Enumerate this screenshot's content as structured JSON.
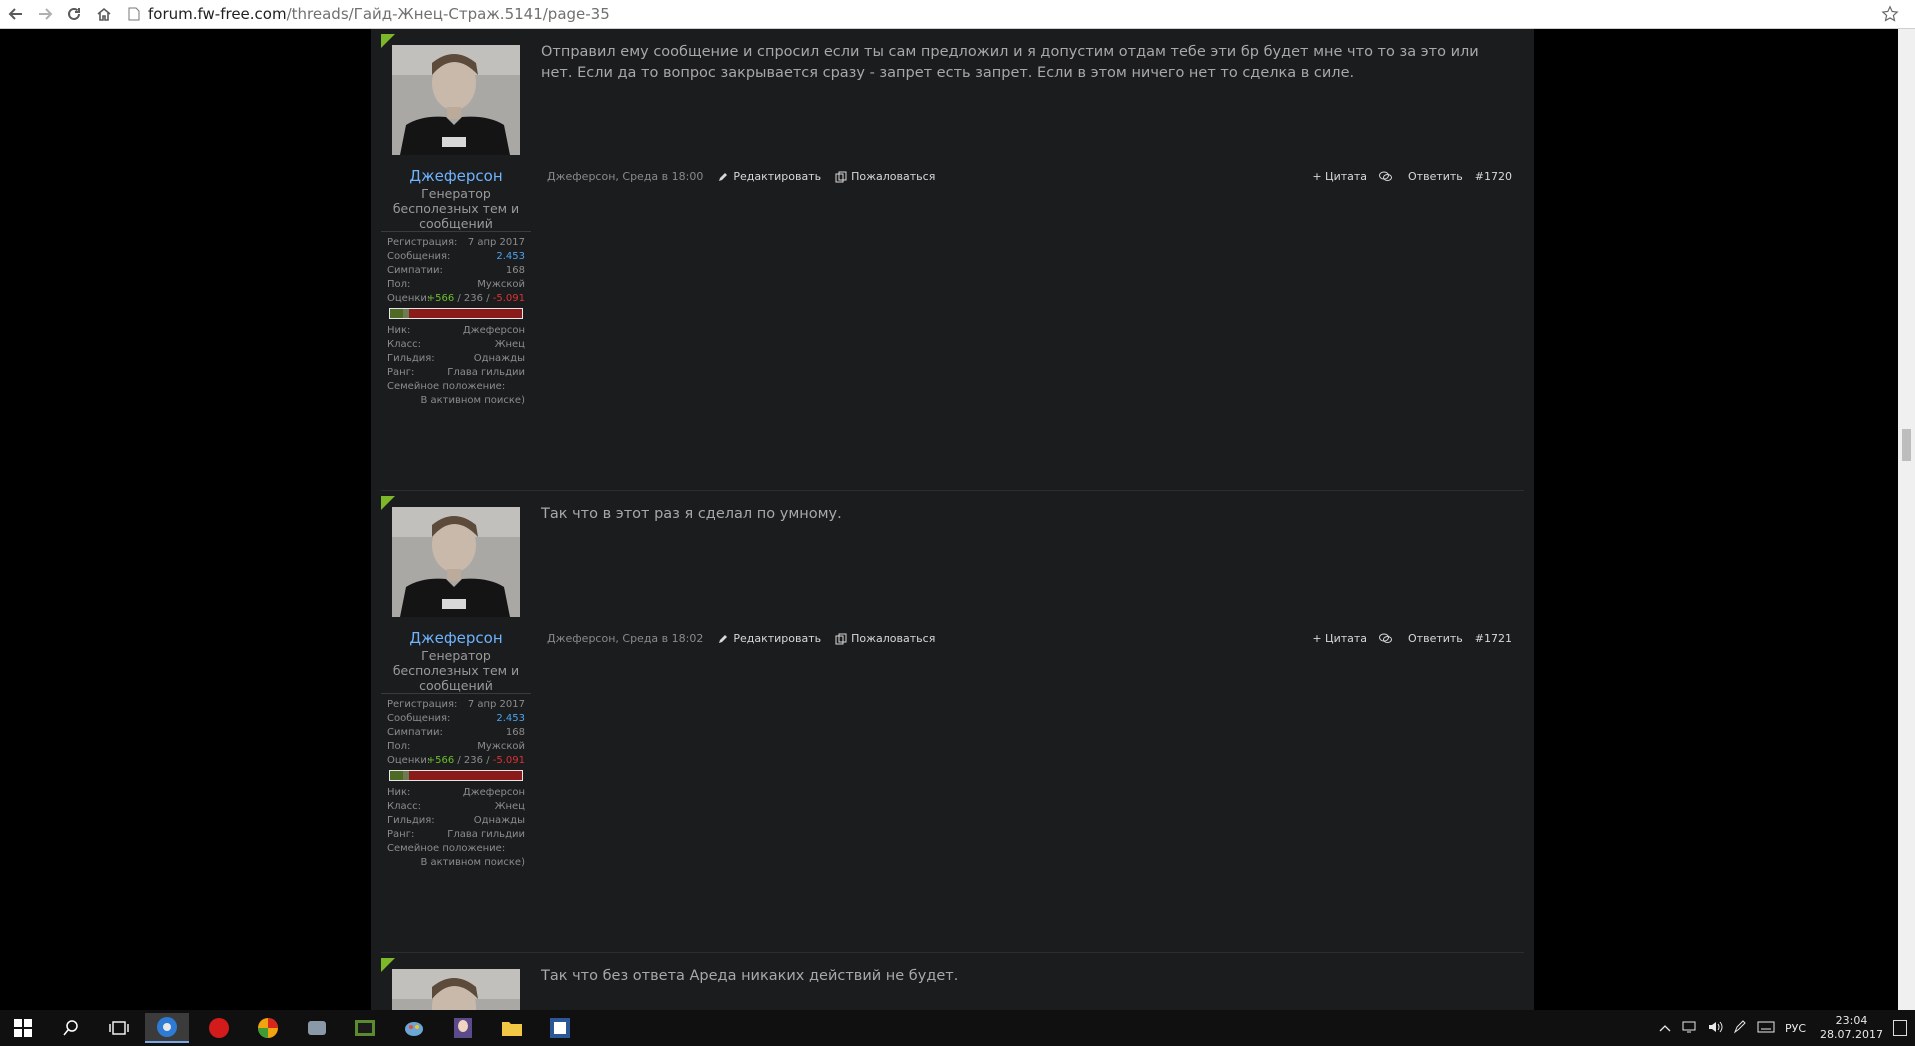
{
  "browser": {
    "url_host": "forum.fw-free.com",
    "url_path": "/threads/Гайд-Жнец-Страж.5141/page-35"
  },
  "labels": {
    "reg": "Регистрация:",
    "msgs": "Сообщения:",
    "likes": "Симпатии:",
    "gender": "Пол:",
    "ratings": "Оценки:",
    "nick": "Ник:",
    "class": "Класс:",
    "guild": "Гильдия:",
    "rank": "Ранг:",
    "family": "Семейное положение:",
    "edit": "Редактировать",
    "report": "Пожаловаться",
    "quote": "+ Цитата",
    "reply": "Ответить"
  },
  "user": {
    "name": "Джеферсон",
    "title": "Генератор бесполезных тем и сообщений",
    "registered": "7 апр 2017",
    "messages": "2.453",
    "likes": "168",
    "gender": "Мужской",
    "rating_pos": "+566",
    "rating_mid": "236",
    "rating_neg": "-5.091",
    "rating_pos_fraction": 0.1,
    "rating_mid_fraction": 0.045,
    "nick": "Джеферсон",
    "class": "Жнец",
    "guild": "Однажды",
    "rank": "Глава гильдии",
    "family_status": "В активном поиске)"
  },
  "posts": [
    {
      "message": "Отправил ему сообщение и спросил если ты сам предложил и я допустим отдам тебе эти бр будет мне что то за это или нет. Если да то вопрос закрывается сразу - запрет есть запрет. Если в этом ничего нет то сделка в силе.",
      "byline": "Джеферсон, Среда в 18:00",
      "number": "#1720"
    },
    {
      "message": "Так что в этот раз я сделал по умному.",
      "byline": "Джеферсон, Среда в 18:02",
      "number": "#1721"
    },
    {
      "message": "Так что без ответа Ареда никаких действий не будет."
    }
  ],
  "taskbar": {
    "lang": "РУС",
    "time": "23:04",
    "date": "28.07.2017"
  },
  "colors": {
    "accent_green": "#7db82a",
    "username_blue": "#6fb4ff",
    "positive": "#6bbf2a",
    "negative": "#e03131",
    "page_bg": "#1b1c1e"
  }
}
